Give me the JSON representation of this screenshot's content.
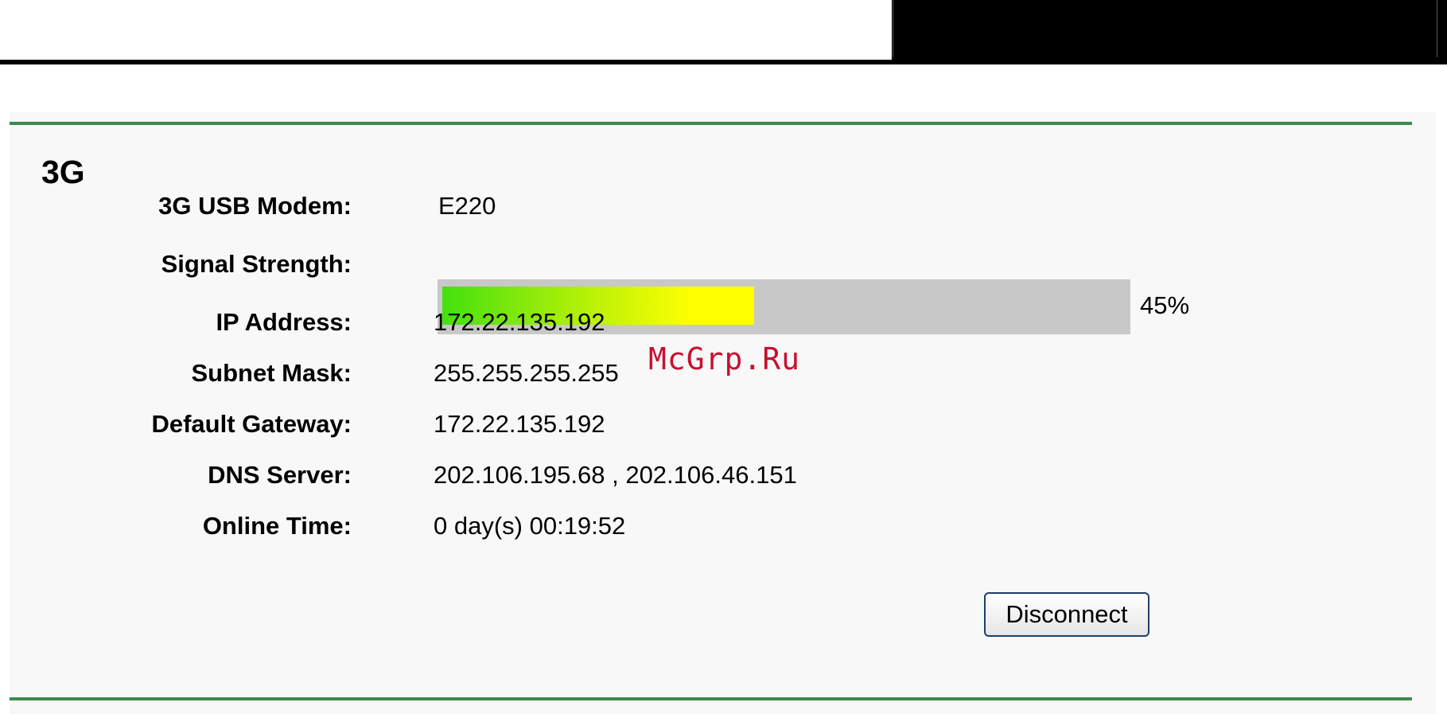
{
  "section": {
    "title": "3G"
  },
  "rows": {
    "modem": {
      "label": "3G USB Modem:",
      "value": "E220"
    },
    "signal": {
      "label": "Signal Strength:",
      "percent_text": "45%",
      "level": 0.45
    },
    "ip": {
      "label": "IP Address:",
      "value": "172.22.135.192"
    },
    "subnet": {
      "label": "Subnet Mask:",
      "value": "255.255.255.255"
    },
    "gateway": {
      "label": "Default Gateway:",
      "value": "172.22.135.192"
    },
    "dns": {
      "label": "DNS Server:",
      "value": "202.106.195.68 , 202.106.46.151"
    },
    "online": {
      "label": "Online Time:",
      "value": "0 day(s) 00:19:52"
    }
  },
  "actions": {
    "disconnect_label": "Disconnect"
  },
  "watermark": "McGrp.Ru",
  "colors": {
    "rule_green": "#3a8a4d",
    "signal_track": "#c8c8c8",
    "signal_start": "#44e010",
    "signal_end": "#ffff00",
    "watermark_red": "#c8102e"
  }
}
